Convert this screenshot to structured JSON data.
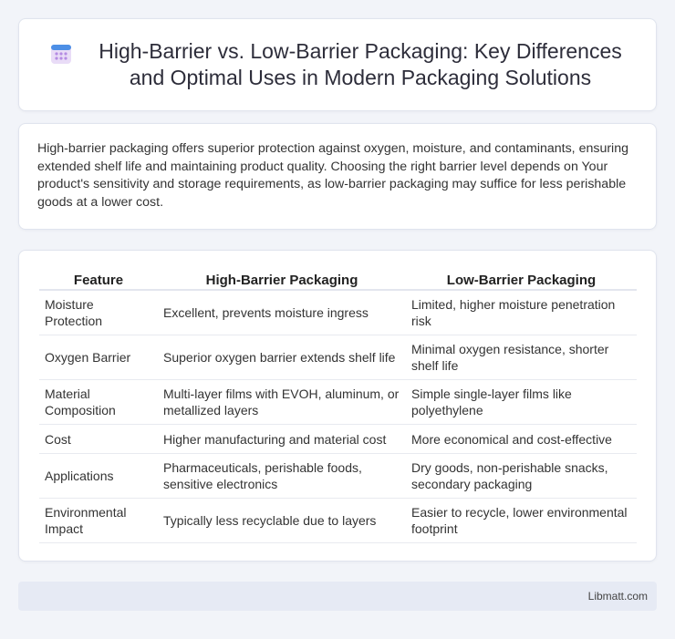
{
  "header": {
    "icon": "calendar-grid-icon",
    "title": "High-Barrier vs. Low-Barrier Packaging: Key Differences and Optimal Uses in Modern Packaging Solutions"
  },
  "intro": {
    "text": "High-barrier packaging offers superior protection against oxygen, moisture, and contaminants, ensuring extended shelf life and maintaining product quality. Choosing the right barrier level depends on Your product's sensitivity and storage requirements, as low-barrier packaging may suffice for less perishable goods at a lower cost."
  },
  "table": {
    "headers": [
      "Feature",
      "High-Barrier Packaging",
      "Low-Barrier Packaging"
    ],
    "rows": [
      [
        "Moisture Protection",
        "Excellent, prevents moisture ingress",
        "Limited, higher moisture penetration risk"
      ],
      [
        "Oxygen Barrier",
        "Superior oxygen barrier extends shelf life",
        "Minimal oxygen resistance, shorter shelf life"
      ],
      [
        "Material Composition",
        "Multi-layer films with EVOH, aluminum, or metallized layers",
        "Simple single-layer films like polyethylene"
      ],
      [
        "Cost",
        "Higher manufacturing and material cost",
        "More economical and cost-effective"
      ],
      [
        "Applications",
        "Pharmaceuticals, perishable foods, sensitive electronics",
        "Dry goods, non-perishable snacks, secondary packaging"
      ],
      [
        "Environmental Impact",
        "Typically less recyclable due to layers",
        "Easier to recycle, lower environmental footprint"
      ]
    ]
  },
  "footer": {
    "text": "Libmatt.com"
  }
}
